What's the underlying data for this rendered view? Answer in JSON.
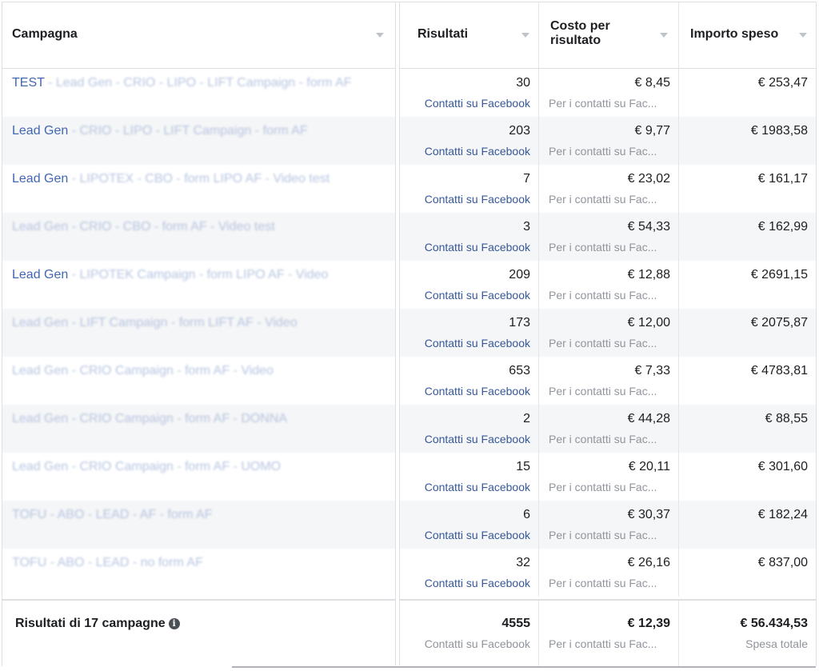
{
  "header": {
    "campaign": "Campagna",
    "results": "Risultati",
    "cost_per_result": "Costo per risultato",
    "amount_spent": "Importo speso"
  },
  "rows": [
    {
      "name_a": "TEST",
      "name_b": " - Lead Gen - CRIO - LIPO - LIFT Campaign - form AF",
      "results": "30",
      "results_label": "Contatti su Facebook",
      "cost": "€ 8,45",
      "cost_label": "Per i contatti su Fac...",
      "spent": "€ 253,47"
    },
    {
      "name_a": "Lead Gen",
      "name_b": " - CRIO - LIPO - LIFT Campaign - form AF",
      "results": "203",
      "results_label": "Contatti su Facebook",
      "cost": "€ 9,77",
      "cost_label": "Per i contatti su Fac...",
      "spent": "€ 1983,58"
    },
    {
      "name_a": "Lead Gen",
      "name_b": " - LIPOTEX - CBO - form LIPO AF - Video test",
      "results": "7",
      "results_label": "Contatti su Facebook",
      "cost": "€ 23,02",
      "cost_label": "Per i contatti su Fac...",
      "spent": "€ 161,17"
    },
    {
      "name_a": "",
      "name_b": "Lead Gen - CRIO - CBO - form AF - Video test",
      "results": "3",
      "results_label": "Contatti su Facebook",
      "cost": "€ 54,33",
      "cost_label": "Per i contatti su Fac...",
      "spent": "€ 162,99"
    },
    {
      "name_a": "Lead Gen",
      "name_b": " - LIPOTEK Campaign - form LIPO AF - Video",
      "results": "209",
      "results_label": "Contatti su Facebook",
      "cost": "€ 12,88",
      "cost_label": "Per i contatti su Fac...",
      "spent": "€ 2691,15"
    },
    {
      "name_a": "",
      "name_b": "Lead Gen - LIFT Campaign - form LIFT AF - Video",
      "results": "173",
      "results_label": "Contatti su Facebook",
      "cost": "€ 12,00",
      "cost_label": "Per i contatti su Fac...",
      "spent": "€ 2075,87"
    },
    {
      "name_a": "",
      "name_b": "Lead Gen - CRIO Campaign - form AF - Video",
      "results": "653",
      "results_label": "Contatti su Facebook",
      "cost": "€ 7,33",
      "cost_label": "Per i contatti su Fac...",
      "spent": "€ 4783,81"
    },
    {
      "name_a": "",
      "name_b": "Lead Gen - CRIO Campaign - form AF - DONNA",
      "results": "2",
      "results_label": "Contatti su Facebook",
      "cost": "€ 44,28",
      "cost_label": "Per i contatti su Fac...",
      "spent": "€ 88,55"
    },
    {
      "name_a": "",
      "name_b": "Lead Gen - CRIO Campaign - form AF - UOMO",
      "results": "15",
      "results_label": "Contatti su Facebook",
      "cost": "€ 20,11",
      "cost_label": "Per i contatti su Fac...",
      "spent": "€ 301,60"
    },
    {
      "name_a": "",
      "name_b": "TOFU - ABO - LEAD - AF - form AF",
      "results": "6",
      "results_label": "Contatti su Facebook",
      "cost": "€ 30,37",
      "cost_label": "Per i contatti su Fac...",
      "spent": "€ 182,24"
    },
    {
      "name_a": "",
      "name_b": "TOFU - ABO - LEAD - no form AF",
      "results": "32",
      "results_label": "Contatti su Facebook",
      "cost": "€ 26,16",
      "cost_label": "Per i contatti su Fac...",
      "spent": "€ 837,00"
    }
  ],
  "footer": {
    "label": "Risultati di 17 campagne",
    "info_glyph": "i",
    "results": "4555",
    "results_label": "Contatti su Facebook",
    "cost": "€ 12,39",
    "cost_label": "Per i contatti su Fac...",
    "spent": "€ 56.434,53",
    "spent_label": "Spesa totale"
  }
}
